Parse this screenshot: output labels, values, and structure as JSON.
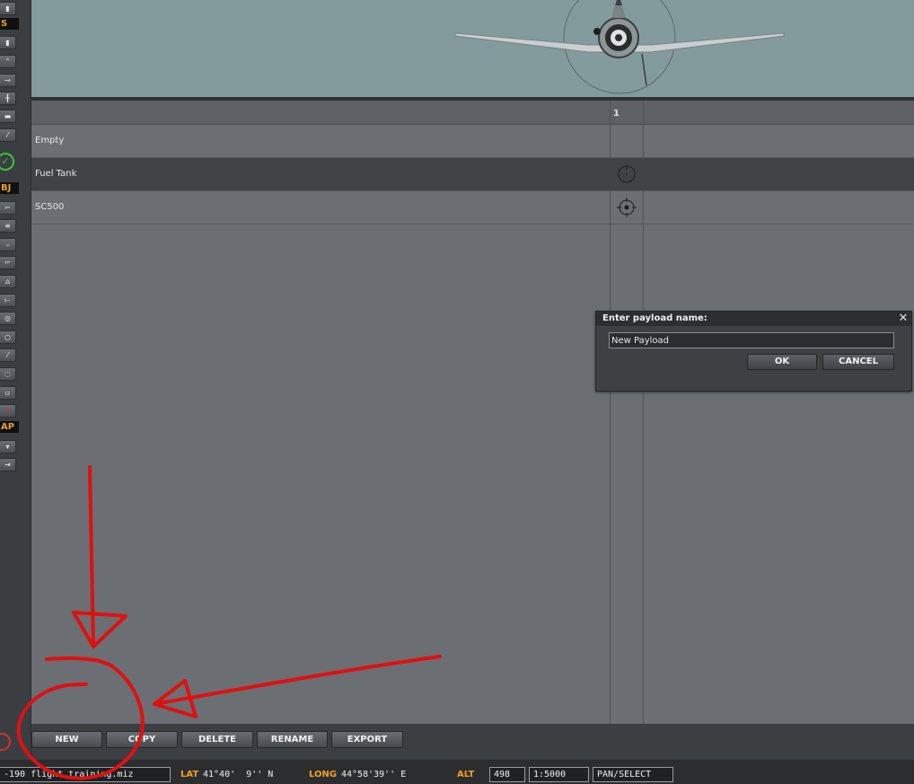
{
  "toolbar": {
    "labels": [
      "S",
      "BJ",
      "AP"
    ]
  },
  "payload_table": {
    "column_header": "1",
    "rows": [
      {
        "name": "Empty",
        "slot_icon": ""
      },
      {
        "name": "Fuel Tank",
        "slot_icon": "fuel-tank-icon"
      },
      {
        "name": "SC500",
        "slot_icon": "bomb-icon"
      }
    ]
  },
  "dialog": {
    "title": "Enter payload name:",
    "input_value": "New Payload",
    "ok_label": "OK",
    "cancel_label": "CANCEL"
  },
  "buttons": {
    "new": "NEW",
    "copy": "COPY",
    "delete": "DELETE",
    "rename": "RENAME",
    "export": "EXPORT"
  },
  "status_bar": {
    "file_name": "-190 flight training.miz",
    "lat_label": "LAT",
    "lat_value": "41°40'  9'' N",
    "long_label": "LONG",
    "long_value": "44°58'39'' E",
    "alt_label": "ALT",
    "alt_value": "498",
    "scale": "1:5000",
    "mode": "PAN/SELECT"
  },
  "colors": {
    "annotation": "#e01010",
    "label_orange": "#f0a020"
  }
}
